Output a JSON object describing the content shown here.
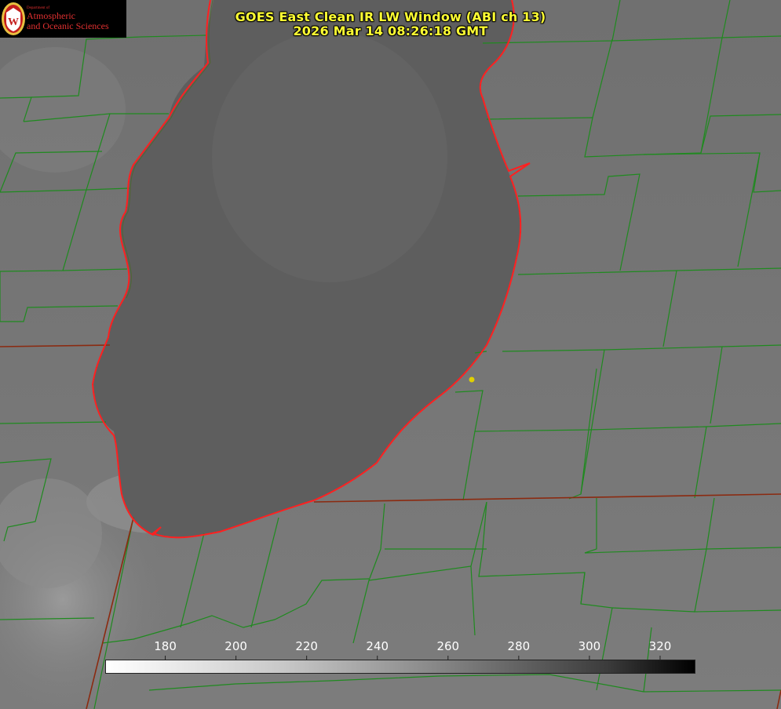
{
  "header": {
    "title_line1": "GOES East Clean IR LW Window (ABI ch 13)",
    "title_line2": "2026 Mar 14 08:26:18 GMT"
  },
  "logo": {
    "small_text": "Department of",
    "line1": "Atmospheric",
    "line2": "and Oceanic Sciences",
    "emblem": "W"
  },
  "colorbar": {
    "min": 163,
    "max": 330,
    "ticks": [
      "180",
      "200",
      "220",
      "240",
      "260",
      "280",
      "300",
      "320"
    ]
  },
  "colors": {
    "title": "#ffff33",
    "county_lines": "#1f8a1f",
    "shoreline": "#ff2020",
    "state_lines": "#8b2a10",
    "marker": "#e0d000"
  },
  "map": {
    "region": "Lake Michigan",
    "marker_icon": "location-dot-icon"
  }
}
